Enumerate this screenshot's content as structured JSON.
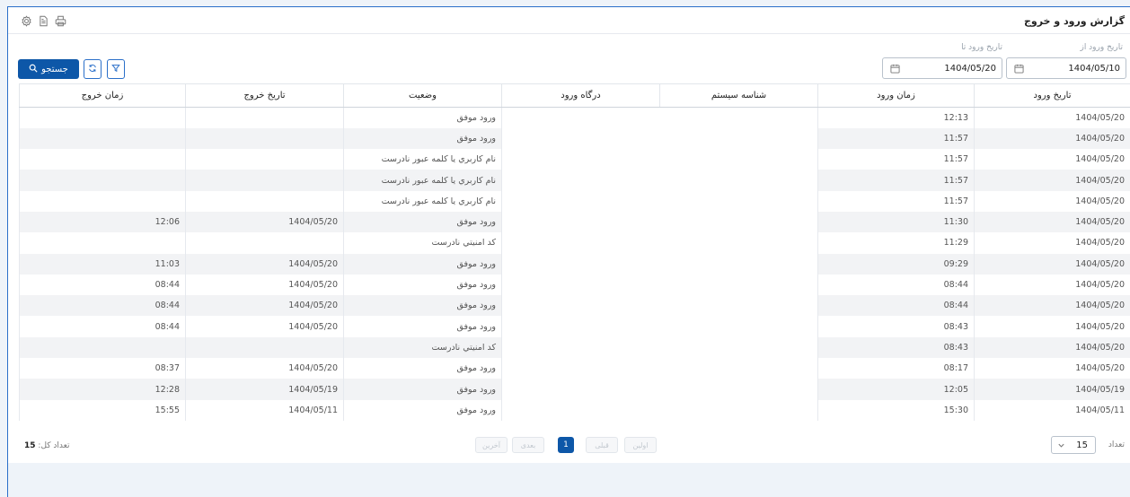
{
  "title": "گزارش ورود و خروج",
  "filters": {
    "from_label": "تاریخ ورود از",
    "from_value": "1404/05/10",
    "to_label": "تاریخ ورود تا",
    "to_value": "1404/05/20"
  },
  "toolbar": {
    "search_label": "جستجو"
  },
  "table": {
    "headers": {
      "entry_date": "تاریخ ورود",
      "entry_time": "زمان ورود",
      "system_id": "شناسه سیستم",
      "gateway": "درگاه ورود",
      "status": "وضعیت",
      "exit_date": "تاریخ خروج",
      "exit_time": "زمان خروج"
    },
    "rows": [
      {
        "entry_date": "1404/05/20",
        "entry_time": "12:13",
        "status": "ورود موفق",
        "exit_date": "",
        "exit_time": ""
      },
      {
        "entry_date": "1404/05/20",
        "entry_time": "11:57",
        "status": "ورود موفق",
        "exit_date": "",
        "exit_time": ""
      },
      {
        "entry_date": "1404/05/20",
        "entry_time": "11:57",
        "status": "نام کاربري يا کلمه عبور نادرست",
        "exit_date": "",
        "exit_time": ""
      },
      {
        "entry_date": "1404/05/20",
        "entry_time": "11:57",
        "status": "نام کاربري يا کلمه عبور نادرست",
        "exit_date": "",
        "exit_time": ""
      },
      {
        "entry_date": "1404/05/20",
        "entry_time": "11:57",
        "status": "نام کاربري يا کلمه عبور نادرست",
        "exit_date": "",
        "exit_time": ""
      },
      {
        "entry_date": "1404/05/20",
        "entry_time": "11:30",
        "status": "ورود موفق",
        "exit_date": "1404/05/20",
        "exit_time": "12:06"
      },
      {
        "entry_date": "1404/05/20",
        "entry_time": "11:29",
        "status": "کد امنيتي نادرست",
        "exit_date": "",
        "exit_time": ""
      },
      {
        "entry_date": "1404/05/20",
        "entry_time": "09:29",
        "status": "ورود موفق",
        "exit_date": "1404/05/20",
        "exit_time": "11:03"
      },
      {
        "entry_date": "1404/05/20",
        "entry_time": "08:44",
        "status": "ورود موفق",
        "exit_date": "1404/05/20",
        "exit_time": "08:44"
      },
      {
        "entry_date": "1404/05/20",
        "entry_time": "08:44",
        "status": "ورود موفق",
        "exit_date": "1404/05/20",
        "exit_time": "08:44"
      },
      {
        "entry_date": "1404/05/20",
        "entry_time": "08:43",
        "status": "ورود موفق",
        "exit_date": "1404/05/20",
        "exit_time": "08:44"
      },
      {
        "entry_date": "1404/05/20",
        "entry_time": "08:43",
        "status": "کد امنيتي نادرست",
        "exit_date": "",
        "exit_time": ""
      },
      {
        "entry_date": "1404/05/20",
        "entry_time": "08:17",
        "status": "ورود موفق",
        "exit_date": "1404/05/20",
        "exit_time": "08:37"
      },
      {
        "entry_date": "1404/05/19",
        "entry_time": "12:05",
        "status": "ورود موفق",
        "exit_date": "1404/05/19",
        "exit_time": "12:28"
      },
      {
        "entry_date": "1404/05/11",
        "entry_time": "15:30",
        "status": "ورود موفق",
        "exit_date": "1404/05/11",
        "exit_time": "15:55"
      }
    ]
  },
  "pager": {
    "count_label": "تعداد",
    "page_size": "15",
    "first": "اولین",
    "prev": "قبلی",
    "current": "1",
    "next": "بعدی",
    "last": "آخرین",
    "total_label": "تعداد کل:",
    "total_value": "15"
  },
  "colors": {
    "primary": "#0d57a8",
    "border": "#2a6fc9",
    "row_alt": "#f2f3f5"
  },
  "icons": [
    "settings-icon",
    "document-icon",
    "print-icon",
    "calendar-icon",
    "search-icon",
    "refresh-icon",
    "filter-icon",
    "chevron-down-icon"
  ]
}
